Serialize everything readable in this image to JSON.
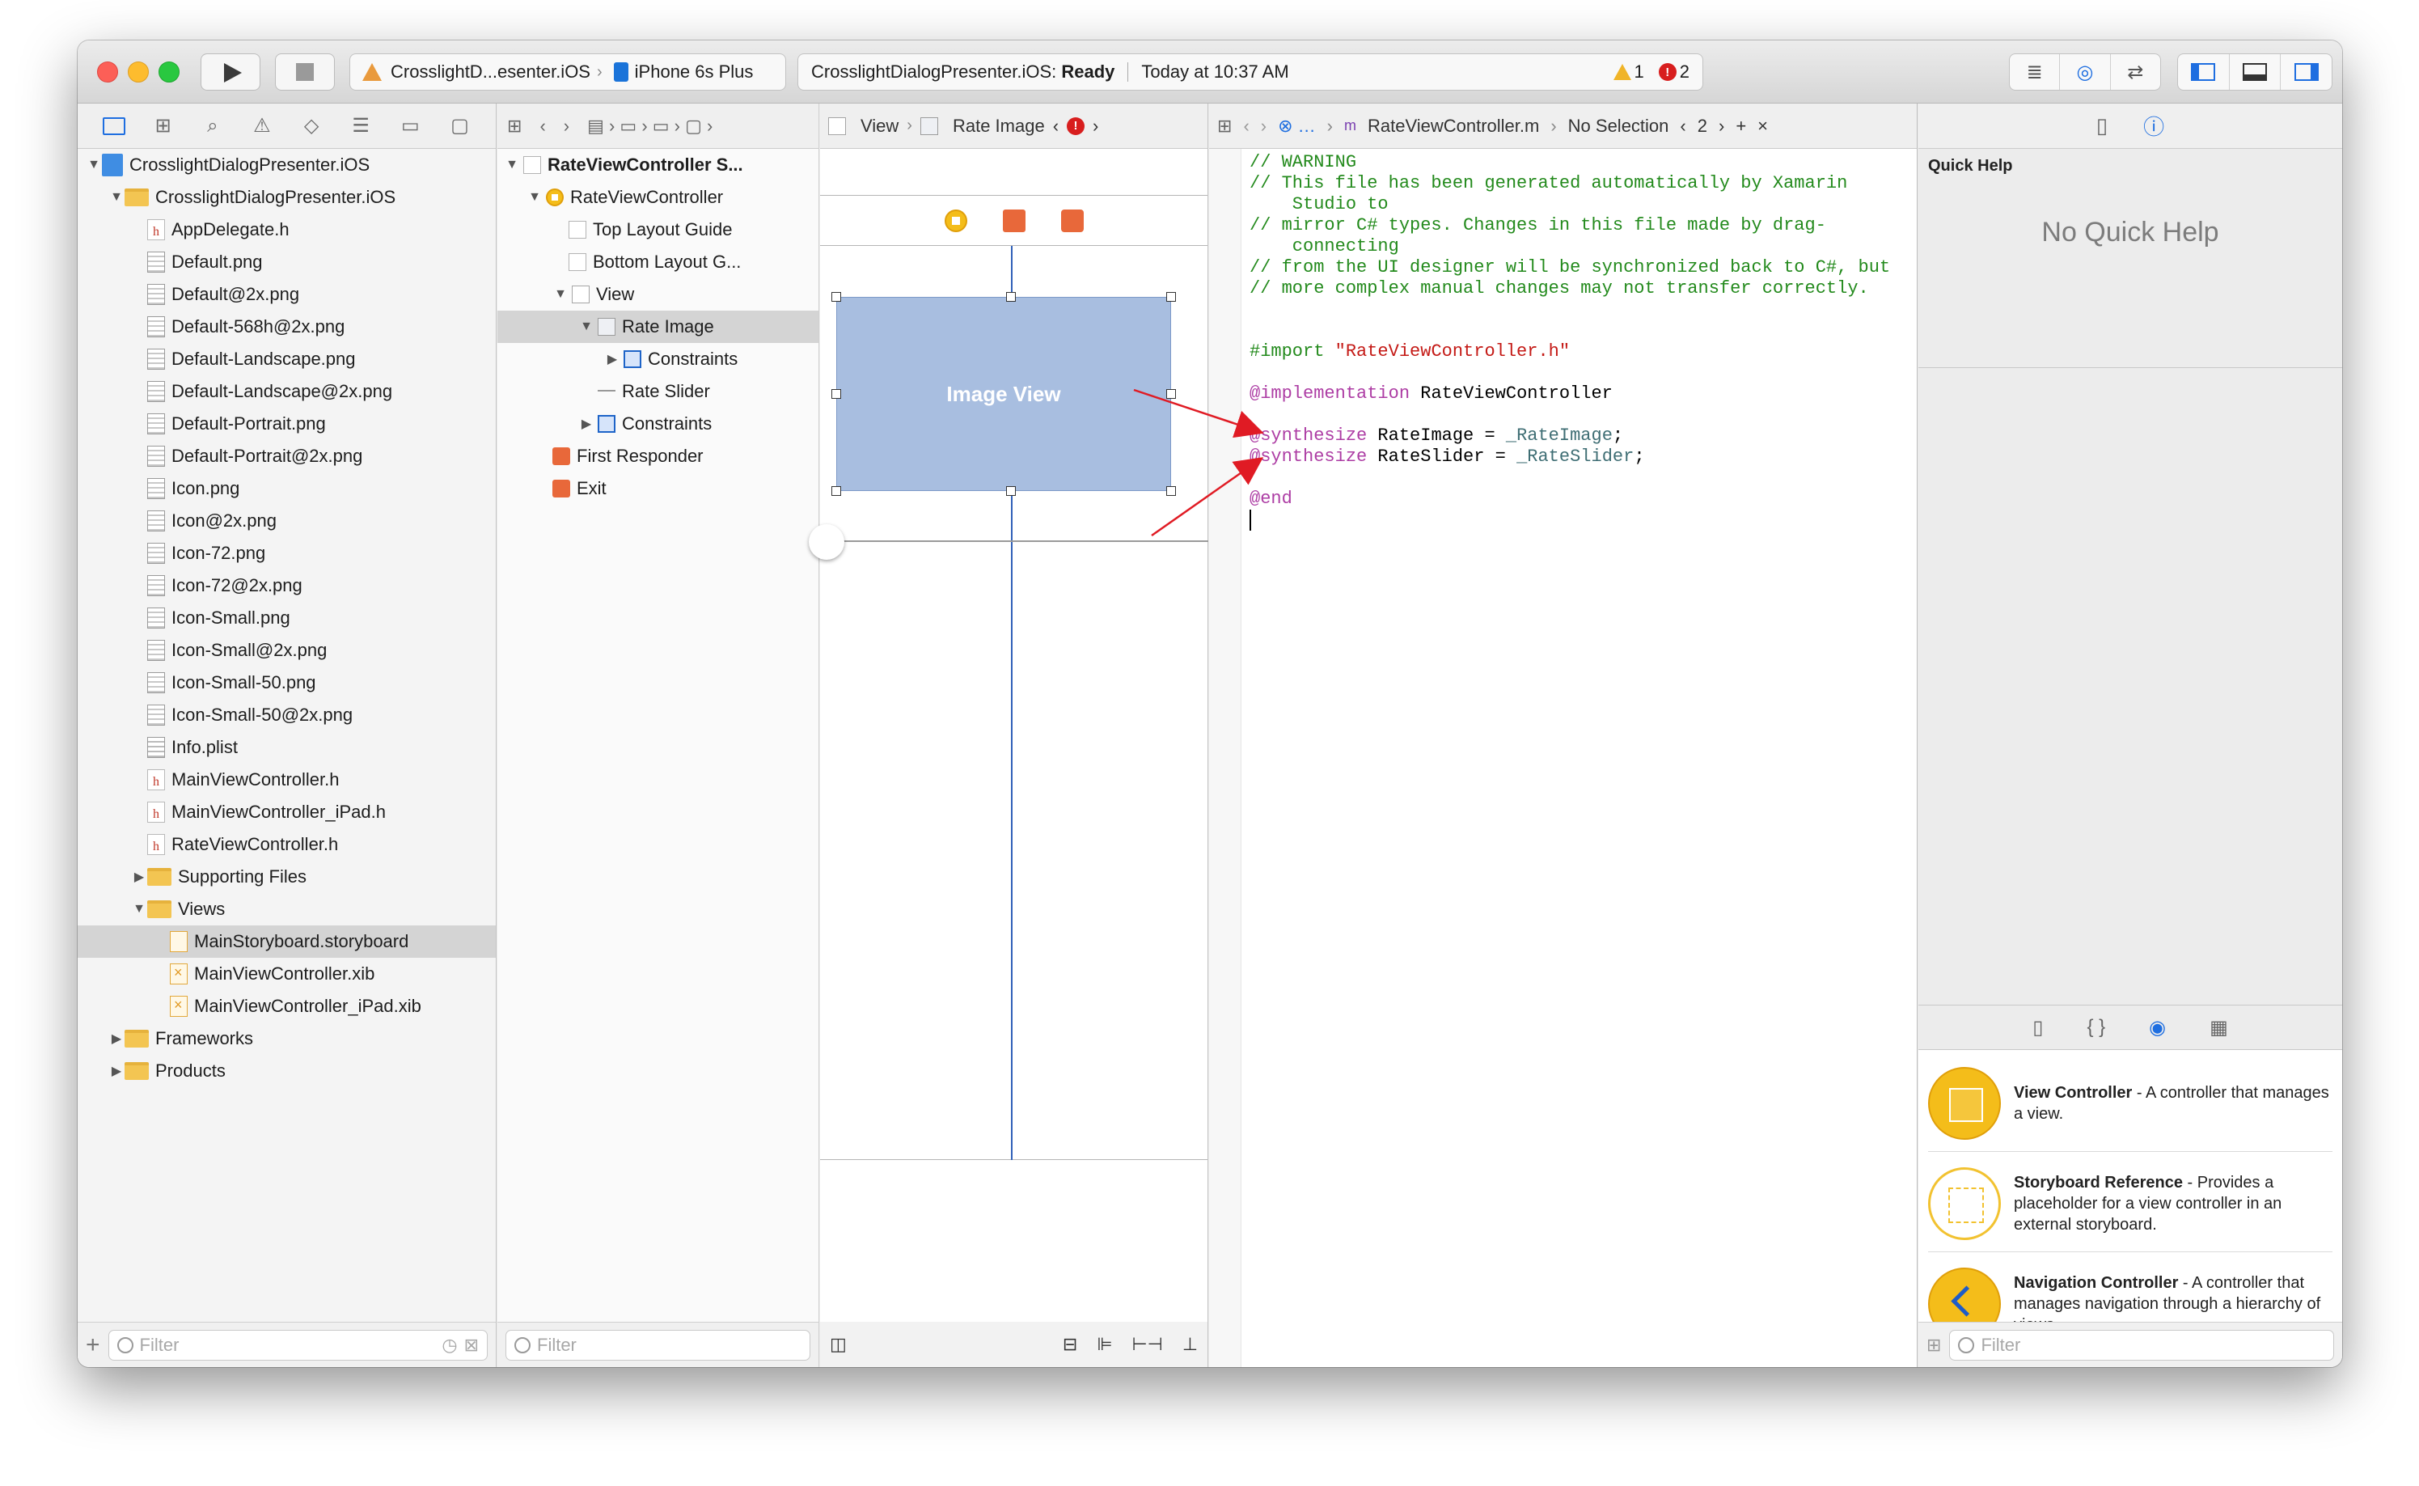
{
  "toolbar": {
    "scheme": "CrosslightD...esenter.iOS",
    "device": "iPhone 6s Plus",
    "activity_project": "CrosslightDialogPresenter.iOS:",
    "activity_status": "Ready",
    "activity_time": "Today at 10:37 AM",
    "warning_count": "1",
    "error_count": "2"
  },
  "navigator": {
    "project": "CrosslightDialogPresenter.iOS",
    "group": "CrosslightDialogPresenter.iOS",
    "files": [
      {
        "name": "AppDelegate.h",
        "kind": "h"
      },
      {
        "name": "Default.png",
        "kind": "png"
      },
      {
        "name": "Default@2x.png",
        "kind": "png"
      },
      {
        "name": "Default-568h@2x.png",
        "kind": "png"
      },
      {
        "name": "Default-Landscape.png",
        "kind": "png"
      },
      {
        "name": "Default-Landscape@2x.png",
        "kind": "png"
      },
      {
        "name": "Default-Portrait.png",
        "kind": "png"
      },
      {
        "name": "Default-Portrait@2x.png",
        "kind": "png"
      },
      {
        "name": "Icon.png",
        "kind": "png"
      },
      {
        "name": "Icon@2x.png",
        "kind": "png"
      },
      {
        "name": "Icon-72.png",
        "kind": "png"
      },
      {
        "name": "Icon-72@2x.png",
        "kind": "png"
      },
      {
        "name": "Icon-Small.png",
        "kind": "png"
      },
      {
        "name": "Icon-Small@2x.png",
        "kind": "png"
      },
      {
        "name": "Icon-Small-50.png",
        "kind": "png"
      },
      {
        "name": "Icon-Small-50@2x.png",
        "kind": "png"
      },
      {
        "name": "Info.plist",
        "kind": "plist"
      },
      {
        "name": "MainViewController.h",
        "kind": "h"
      },
      {
        "name": "MainViewController_iPad.h",
        "kind": "h"
      },
      {
        "name": "RateViewController.h",
        "kind": "h"
      }
    ],
    "supporting_files": "Supporting Files",
    "views_group": "Views",
    "views_files": [
      {
        "name": "MainStoryboard.storyboard",
        "kind": "sb",
        "selected": true
      },
      {
        "name": "MainViewController.xib",
        "kind": "xib"
      },
      {
        "name": "MainViewController_iPad.xib",
        "kind": "xib"
      }
    ],
    "frameworks": "Frameworks",
    "products": "Products",
    "filter_placeholder": "Filter"
  },
  "outline": {
    "scene": "RateViewController S...",
    "controller": "RateViewController",
    "top_guide": "Top Layout Guide",
    "bottom_guide": "Bottom Layout G...",
    "view": "View",
    "rate_image": "Rate Image",
    "constraints_inner": "Constraints",
    "rate_slider": "Rate Slider",
    "constraints_outer": "Constraints",
    "first_responder": "First Responder",
    "exit": "Exit",
    "filter_placeholder": "Filter"
  },
  "canvas": {
    "breadcrumb_view": "View",
    "breadcrumb_rate_image": "Rate Image",
    "image_view_label": "Image View"
  },
  "code": {
    "file": "RateViewController.m",
    "selection": "No Selection",
    "counter": "2",
    "lines": {
      "l1": "// WARNING",
      "l2": "// This file has been generated automatically by Xamarin",
      "l3": "    Studio to",
      "l4": "// mirror C# types. Changes in this file made by drag-",
      "l5": "    connecting",
      "l6": "// from the UI designer will be synchronized back to C#, but",
      "l7": "// more complex manual changes may not transfer correctly.",
      "import_kw": "#import",
      "import_str": "\"RateViewController.h\"",
      "impl_kw": "@implementation",
      "impl_name": " RateViewController",
      "syn_kw": "@synthesize",
      "syn1_name": " RateImage = ",
      "syn1_var": "_RateImage",
      "syn2_name": " RateSlider = ",
      "syn2_var": "_RateSlider",
      "semi": ";",
      "end_kw": "@end"
    }
  },
  "inspector": {
    "quick_help_title": "Quick Help",
    "no_help": "No Quick Help",
    "library": [
      {
        "title": "View Controller",
        "desc": " - A controller that manages a view."
      },
      {
        "title": "Storyboard Reference",
        "desc": " - Provides a placeholder for a view controller in an external storyboard."
      },
      {
        "title": "Navigation Controller",
        "desc": " - A controller that manages navigation through a hierarchy of views."
      }
    ],
    "filter_placeholder": "Filter"
  }
}
